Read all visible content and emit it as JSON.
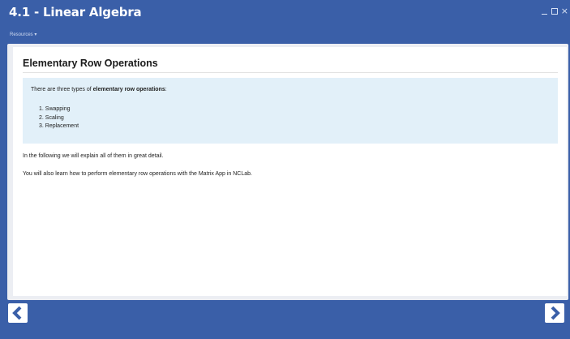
{
  "window": {
    "title": "4.1 - Linear Algebra",
    "controls": {
      "minimize": "_",
      "maximize": "□",
      "close": "×"
    }
  },
  "menu": {
    "resources_label": "Resources ▾"
  },
  "lesson": {
    "heading": "Elementary Row Operations",
    "intro_prefix": "There are three types of ",
    "intro_bold": "elementary row operations",
    "intro_suffix": ":",
    "items": [
      "1. Swapping",
      "2. Scaling",
      "3. Replacement"
    ],
    "paragraph1": "In the following we will explain all of them in great detail.",
    "paragraph2": "You will also learn how to perform elementary row operations with the Matrix App in NCLab."
  },
  "navigation": {
    "prev_icon": "chevron-left-icon",
    "next_icon": "chevron-right-icon"
  },
  "colors": {
    "background": "#3a5fa8",
    "info_box": "#e2f0f9",
    "nav_arrow": "#3a5fa8"
  }
}
